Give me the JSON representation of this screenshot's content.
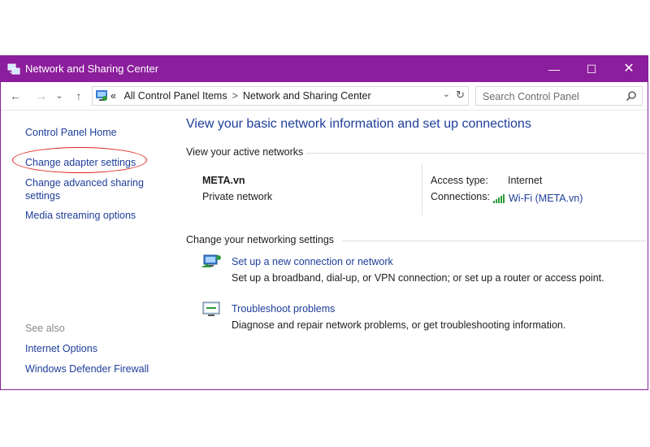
{
  "window": {
    "title": "Network and Sharing Center"
  },
  "controls": {
    "minimize": "—",
    "maximize": "☐",
    "close": "✕"
  },
  "nav": {
    "back": "←",
    "forward": "→",
    "recent": "⌄",
    "up": "↑"
  },
  "address": {
    "prefix": "«",
    "crumbs": [
      "All Control Panel Items",
      "Network and Sharing Center"
    ],
    "separator": ">",
    "dropdown": "⌄",
    "refresh": "↻"
  },
  "search": {
    "placeholder": "Search Control Panel",
    "icon": "search-icon"
  },
  "sidebar": {
    "links": [
      "Control Panel Home",
      "Change adapter settings",
      "Change advanced sharing",
      "settings",
      "Media streaming options"
    ],
    "see_also_label": "See also",
    "see_also": [
      "Internet Options",
      "Windows Defender Firewall"
    ]
  },
  "main": {
    "heading": "View your basic network information and set up connections",
    "active_label": "View your active networks",
    "network": {
      "name": "META.vn",
      "type": "Private network",
      "access_label": "Access type:",
      "access_value": "Internet",
      "connections_label": "Connections:",
      "connection_value": "Wi-Fi (META.vn)"
    },
    "change_label": "Change your networking settings",
    "tasks": [
      {
        "title": "Set up a new connection or network",
        "desc": "Set up a broadband, dial-up, or VPN connection; or set up a router or access point."
      },
      {
        "title": "Troubleshoot problems",
        "desc": "Diagnose and repair network problems, or get troubleshooting information."
      }
    ]
  },
  "colors": {
    "titlebar": "#8b1e9c",
    "link": "#1e3e9a",
    "highlight": "#e02020"
  }
}
